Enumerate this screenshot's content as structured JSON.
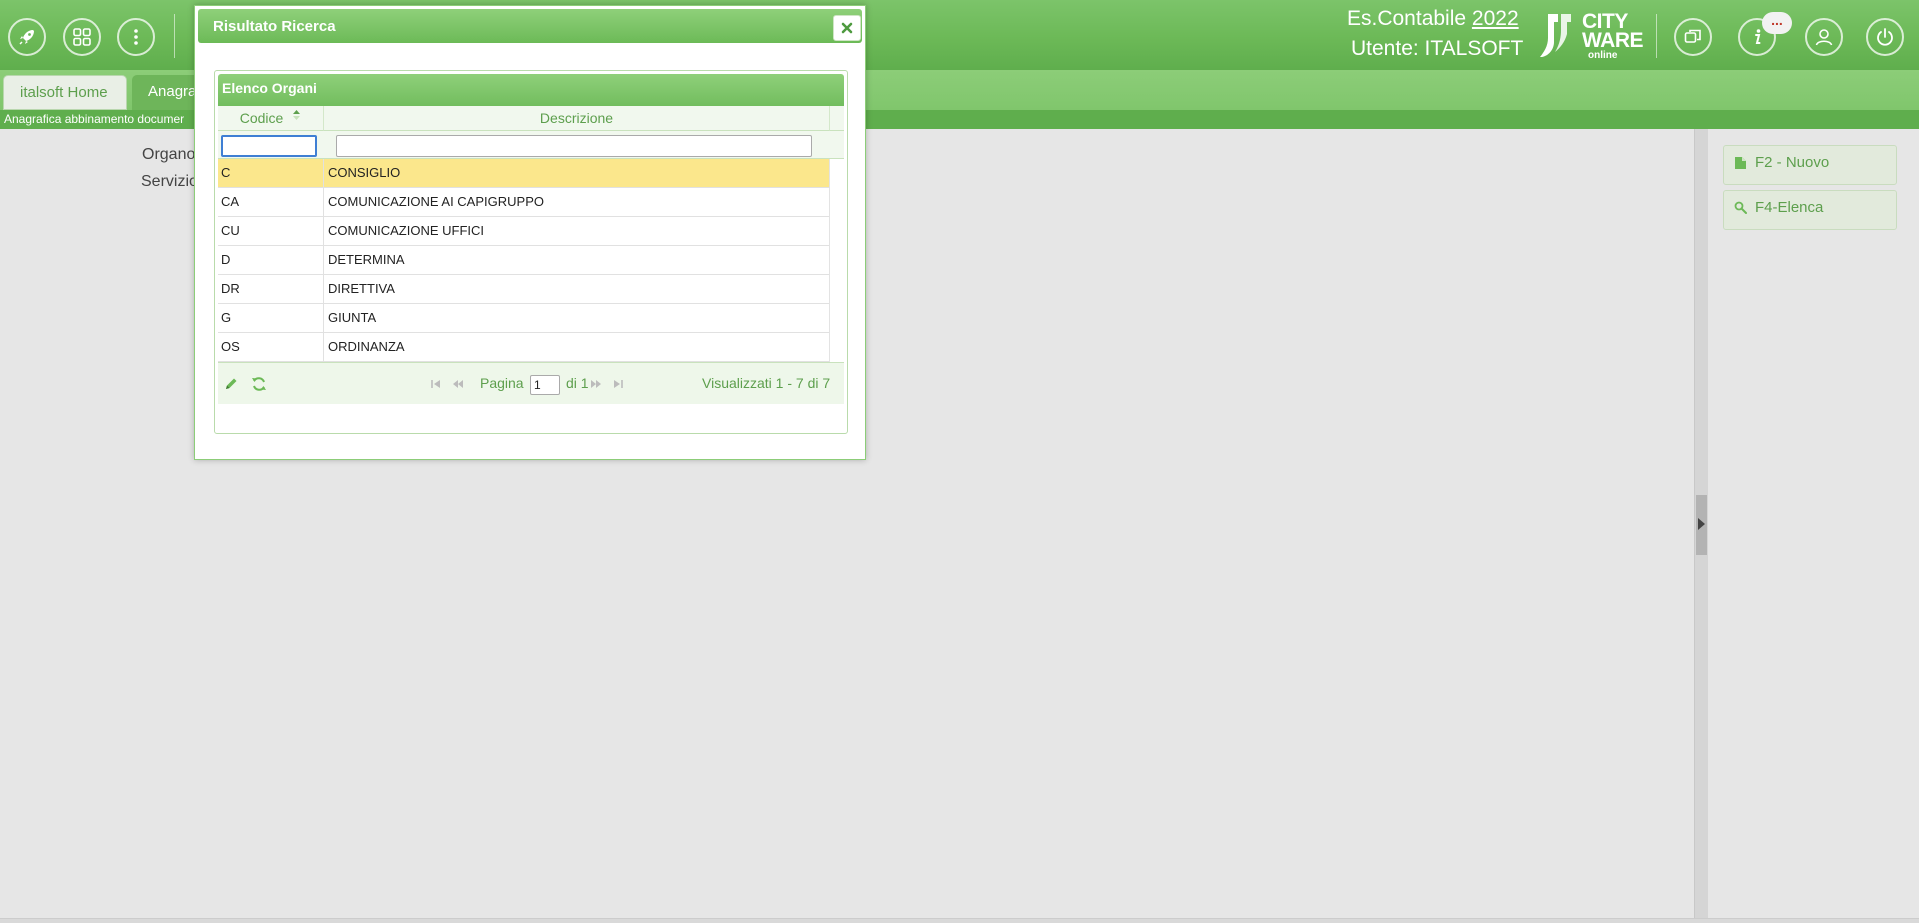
{
  "header": {
    "icons": [
      "rocket-icon",
      "apps-grid-icon",
      "more-vertical-icon",
      "windows-icon",
      "info-icon",
      "user-icon",
      "power-icon"
    ],
    "es_contabile_label": "Es.Contabile",
    "es_contabile_year": "2022",
    "utente_label": "Utente: ITALSOFT",
    "logo": {
      "line1": "CITY",
      "line2": "WARE",
      "sub": "online"
    },
    "notification_badge": "..."
  },
  "tabs": [
    {
      "label": "italsoft Home",
      "active": false
    },
    {
      "label": "Anagra",
      "active": true
    }
  ],
  "breadcrumb": "Anagrafica abbinamento documer",
  "form": {
    "organo_label": "Organo",
    "servizio_label": "Servizio"
  },
  "side_actions": [
    {
      "label": "F2 - Nuovo",
      "icon": "document-icon"
    },
    {
      "label": "F4-Elenca",
      "icon": "search-icon"
    }
  ],
  "modal": {
    "title": "Risultato Ricerca",
    "grid": {
      "title": "Elenco Organi",
      "columns": [
        "Codice",
        "Descrizione"
      ],
      "filter_codice": "",
      "filter_descrizione": "",
      "rows": [
        {
          "codice": "C",
          "descrizione": "CONSIGLIO",
          "selected": true
        },
        {
          "codice": "CA",
          "descrizione": "COMUNICAZIONE AI CAPIGRUPPO",
          "selected": false
        },
        {
          "codice": "CU",
          "descrizione": "COMUNICAZIONE UFFICI",
          "selected": false
        },
        {
          "codice": "D",
          "descrizione": "DETERMINA",
          "selected": false
        },
        {
          "codice": "DR",
          "descrizione": "DIRETTIVA",
          "selected": false
        },
        {
          "codice": "G",
          "descrizione": "GIUNTA",
          "selected": false
        },
        {
          "codice": "OS",
          "descrizione": "ORDINANZA",
          "selected": false
        }
      ],
      "pager": {
        "pagina_label": "Pagina",
        "page": "1",
        "of_label": "di 1",
        "summary": "Visualizzati 1 - 7 di 7"
      }
    }
  },
  "colors": {
    "brand_green": "#6cb957",
    "text_green": "#5d9f4d",
    "selected_row": "#fbe78c"
  }
}
